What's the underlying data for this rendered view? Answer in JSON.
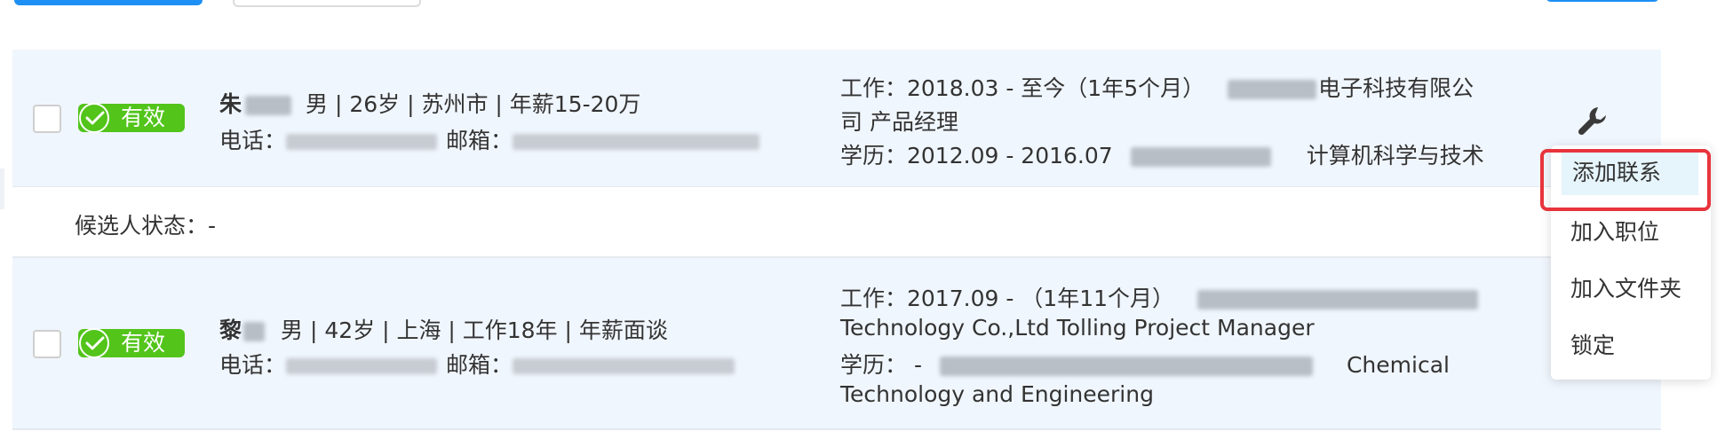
{
  "badge_label": "有效",
  "candidate_status": "候选人状态：-",
  "candidates": [
    {
      "name": "朱",
      "info": "男 | 26岁 | 苏州市 | 年薪15-20万",
      "phone_label": "电话：",
      "email_label": "邮箱：",
      "work_line1_prefix": "工作：2018.03 - 至今（1年5个月）",
      "work_line1_suffix": "电子科技有限公",
      "work_line2": "司  产品经理",
      "edu_prefix": "学历：2012.09 - 2016.07",
      "edu_major": "计算机科学与技术"
    },
    {
      "name": "黎",
      "info": "男 | 42岁 | 上海 | 工作18年 | 年薪面谈",
      "phone_label": "电话：",
      "email_label": "邮箱：",
      "work_line1_prefix": "工作：2017.09 - （1年11个月）",
      "work_line2": "Technology Co.,Ltd   Tolling Project Manager",
      "edu_prefix": "学历：  -",
      "edu_major": "Chemical",
      "edu_line2": "Technology and Engineering"
    }
  ],
  "action_menu": {
    "icon": "wrench-icon",
    "items": [
      "添加联系",
      "加入职位",
      "加入文件夹",
      "锁定"
    ],
    "highlight_color": "#e8343c"
  },
  "colors": {
    "primary": "#1e8ff5",
    "badge": "#52c41a",
    "card_bg": "#f0f6fd"
  }
}
